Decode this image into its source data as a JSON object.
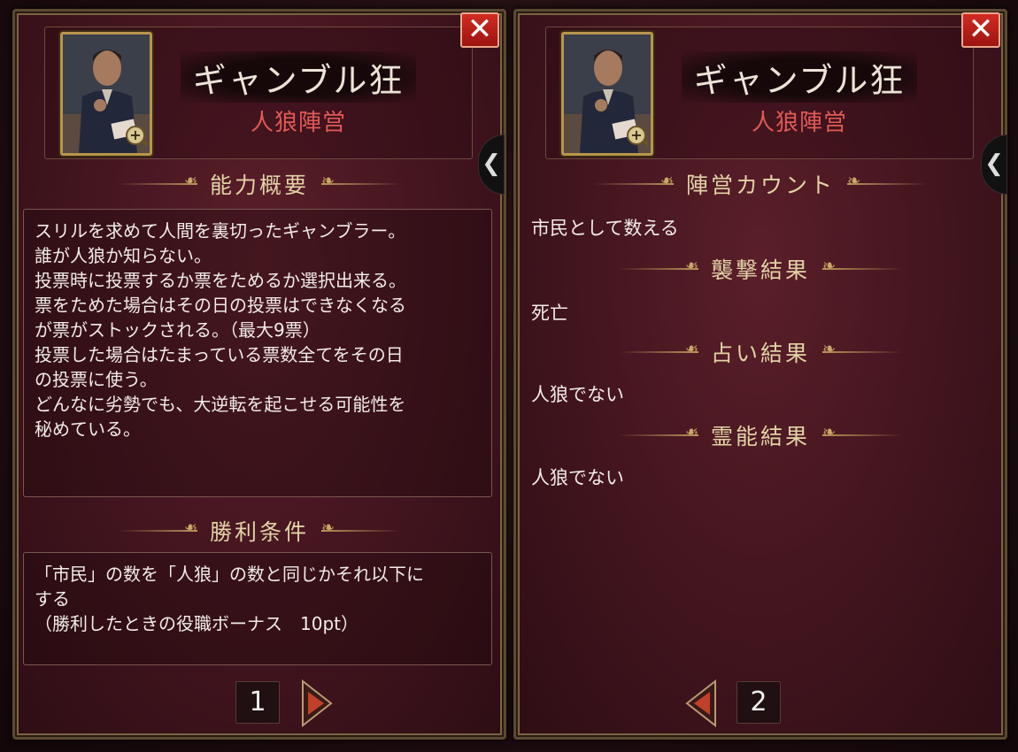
{
  "left_panel": {
    "role_name": "ギャンブル狂",
    "faction": "人狼陣営",
    "ability_title": "能力概要",
    "ability_lines": [
      "スリルを求めて人間を裏切ったギャンブラー。",
      "誰が人狼か知らない。",
      "投票時に投票するか票をためるか選択出来る。",
      "票をためた場合はその日の投票はできなくなる",
      "が票がストックされる。（最大9票）",
      "投票した場合はたまっている票数全てをその日",
      "の投票に使う。",
      "どんなに劣勢でも、大逆転を起こせる可能性を",
      "秘めている。"
    ],
    "victory_title": "勝利条件",
    "victory_lines": [
      "「市民」の数を「人狼」の数と同じかそれ以下に",
      "する",
      "（勝利したときの役職ボーナス　10pt）"
    ],
    "page_number": "1",
    "close_label": "✕",
    "side_tab_label": "❮"
  },
  "right_panel": {
    "role_name": "ギャンブル狂",
    "faction": "人狼陣営",
    "sections": [
      {
        "title": "陣営カウント",
        "value": "市民として数える"
      },
      {
        "title": "襲撃結果",
        "value": "死亡"
      },
      {
        "title": "占い結果",
        "value": "人狼でない"
      },
      {
        "title": "霊能結果",
        "value": "人狼でない"
      }
    ],
    "page_number": "2",
    "close_label": "✕",
    "side_tab_label": "❮"
  },
  "icons": {
    "close": "close-icon",
    "zoom": "zoom-in-icon",
    "next": "next-page-arrow-icon",
    "prev": "prev-page-arrow-icon",
    "side_tab": "chevron-left-icon"
  },
  "colors": {
    "panel_bg": "#461620",
    "faction_red": "#e05a56",
    "title_gold": "#e2d2a6",
    "close_red": "#c8241c"
  }
}
